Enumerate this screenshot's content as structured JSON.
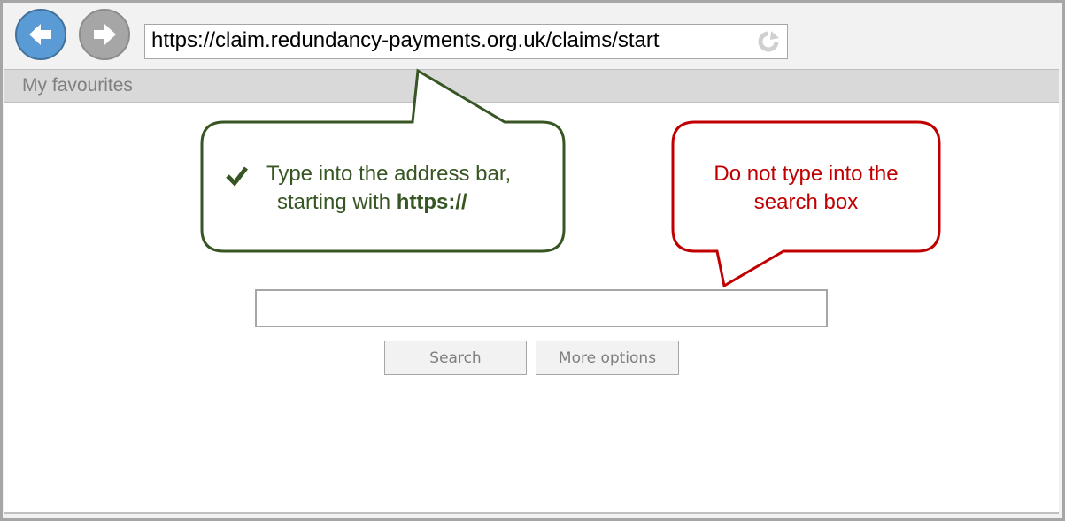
{
  "browser": {
    "address_url": "https://claim.redundancy-payments.org.uk/claims/start",
    "favourites_label": "My favourites",
    "back_icon": "arrow-left-icon",
    "forward_icon": "arrow-right-icon",
    "refresh_icon": "refresh-icon"
  },
  "callouts": {
    "good": {
      "line1": "Type into the address bar,",
      "line2_prefix": "starting with ",
      "line2_bold": "https://",
      "color": "#375623"
    },
    "bad": {
      "line1": "Do not type into the",
      "line2": "search box",
      "color": "#c00000"
    }
  },
  "search": {
    "value": "",
    "search_button": "Search",
    "more_button": "More options"
  },
  "colors": {
    "back_button": "#5b9bd5",
    "forward_button": "#a6a6a6"
  }
}
